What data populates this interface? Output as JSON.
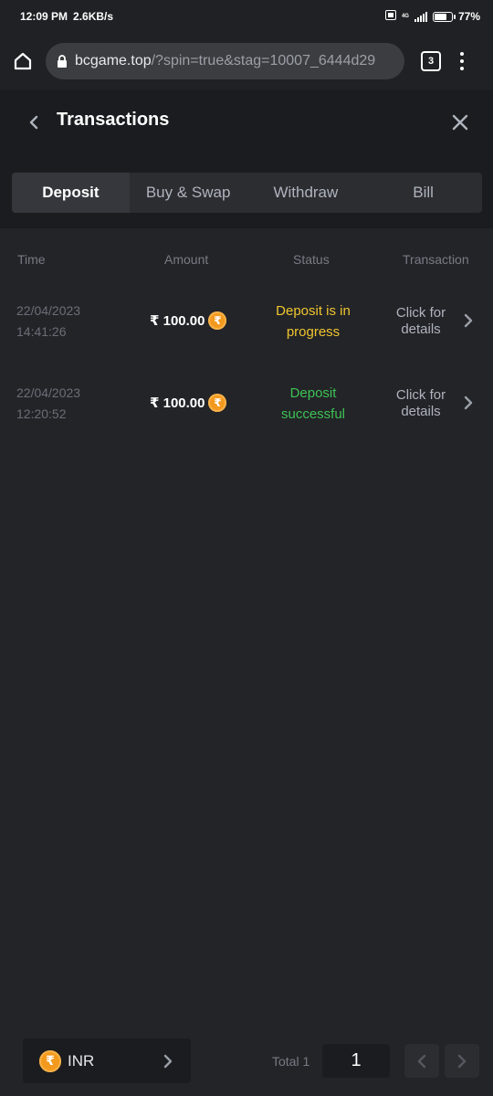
{
  "status_bar": {
    "time": "12:09 PM",
    "speed": "2.6KB/s",
    "network": "4G",
    "battery": "77",
    "battery_fraction": 0.77
  },
  "browser": {
    "url_host": "bcgame.top",
    "url_path": "/?spin=true&stag=10007_6444d29",
    "tab_count": "3"
  },
  "header": {
    "title": "Transactions"
  },
  "tabs": [
    {
      "label": "Deposit",
      "active": true
    },
    {
      "label": "Buy & Swap",
      "active": false
    },
    {
      "label": "Withdraw",
      "active": false
    },
    {
      "label": "Bill",
      "active": false
    }
  ],
  "table": {
    "columns": [
      "Time",
      "Amount",
      "Status",
      "Transaction"
    ],
    "rows": [
      {
        "date": "22/04/2023",
        "time": "14:41:26",
        "amount": "₹ 100.00",
        "status_line1": "Deposit is in",
        "status_line2": "progress",
        "status_type": "progress",
        "details_line1": "Click for",
        "details_line2": "details"
      },
      {
        "date": "22/04/2023",
        "time": "12:20:52",
        "amount": "₹ 100.00",
        "status_line1": "Deposit",
        "status_line2": "successful",
        "status_type": "success",
        "details_line1": "Click for",
        "details_line2": "details"
      }
    ]
  },
  "footer": {
    "currency_symbol": "₹",
    "currency_code": "INR",
    "total_label": "Total 1",
    "current_page": "1"
  },
  "colors": {
    "background": "#232428",
    "panel": "#1b1c1f",
    "progress": "#f0c52e",
    "success": "#3dc254",
    "coin": "#f39a1e"
  }
}
